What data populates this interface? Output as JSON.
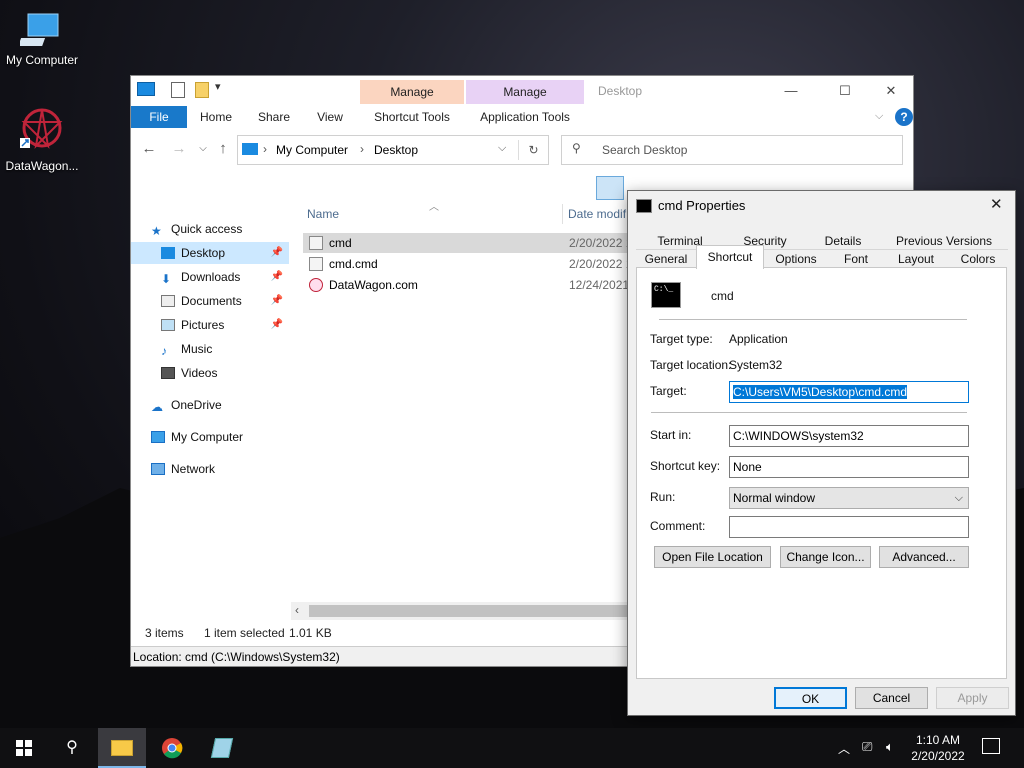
{
  "desktop": {
    "icons": [
      {
        "label": "My Computer",
        "icon": "monitor-icon"
      },
      {
        "label": "DataWagon...",
        "icon": "datawagon-logo-icon"
      }
    ]
  },
  "explorer": {
    "title": "Desktop",
    "context_tabs": [
      {
        "group": "Manage",
        "label": "Shortcut Tools",
        "color": "#fbd5c0"
      },
      {
        "group": "Manage",
        "label": "Application Tools",
        "color": "#e8d2f5"
      }
    ],
    "ribbon_tabs": [
      "File",
      "Home",
      "Share",
      "View"
    ],
    "address": {
      "root": "My Computer",
      "current": "Desktop"
    },
    "search_placeholder": "Search Desktop",
    "columns": {
      "name": "Name",
      "date": "Date modif"
    },
    "nav": [
      {
        "label": "Quick access",
        "icon": "star-icon"
      },
      {
        "label": "Desktop",
        "icon": "desktop-folder-icon",
        "selected": true,
        "pinned": true
      },
      {
        "label": "Downloads",
        "icon": "download-icon",
        "pinned": true
      },
      {
        "label": "Documents",
        "icon": "documents-icon",
        "pinned": true
      },
      {
        "label": "Pictures",
        "icon": "pictures-icon",
        "pinned": true
      },
      {
        "label": "Music",
        "icon": "music-icon"
      },
      {
        "label": "Videos",
        "icon": "videos-icon"
      },
      {
        "label": "OneDrive",
        "icon": "cloud-icon"
      },
      {
        "label": "My Computer",
        "icon": "computer-icon"
      },
      {
        "label": "Network",
        "icon": "network-icon"
      }
    ],
    "files": [
      {
        "name": "cmd",
        "date": "2/20/2022 1",
        "selected": true
      },
      {
        "name": "cmd.cmd",
        "date": "2/20/2022 1"
      },
      {
        "name": "DataWagon.com",
        "date": "12/24/2021"
      }
    ],
    "status": {
      "items": "3 items",
      "selected": "1 item selected",
      "size": "1.01 KB"
    },
    "location_bar": "Location: cmd (C:\\Windows\\System32)"
  },
  "dialog": {
    "title": "cmd Properties",
    "tabs_row1": [
      "Terminal",
      "Security",
      "Details",
      "Previous Versions"
    ],
    "tabs_row2": [
      "General",
      "Shortcut",
      "Options",
      "Font",
      "Layout",
      "Colors"
    ],
    "active_tab": "Shortcut",
    "shortcut_name": "cmd",
    "target_type_label": "Target type:",
    "target_type": "Application",
    "target_location_label": "Target location:",
    "target_location": "System32",
    "target_label": "Target:",
    "target": "C:\\Users\\VM5\\Desktop\\cmd.cmd",
    "start_in_label": "Start in:",
    "start_in": "C:\\WINDOWS\\system32",
    "shortcut_key_label": "Shortcut key:",
    "shortcut_key": "None",
    "run_label": "Run:",
    "run": "Normal window",
    "comment_label": "Comment:",
    "comment": "",
    "buttons": {
      "open_location": "Open File Location",
      "change_icon": "Change Icon...",
      "advanced": "Advanced..."
    },
    "footer": {
      "ok": "OK",
      "cancel": "Cancel",
      "apply": "Apply"
    }
  },
  "taskbar": {
    "time": "1:10 AM",
    "date": "2/20/2022"
  }
}
